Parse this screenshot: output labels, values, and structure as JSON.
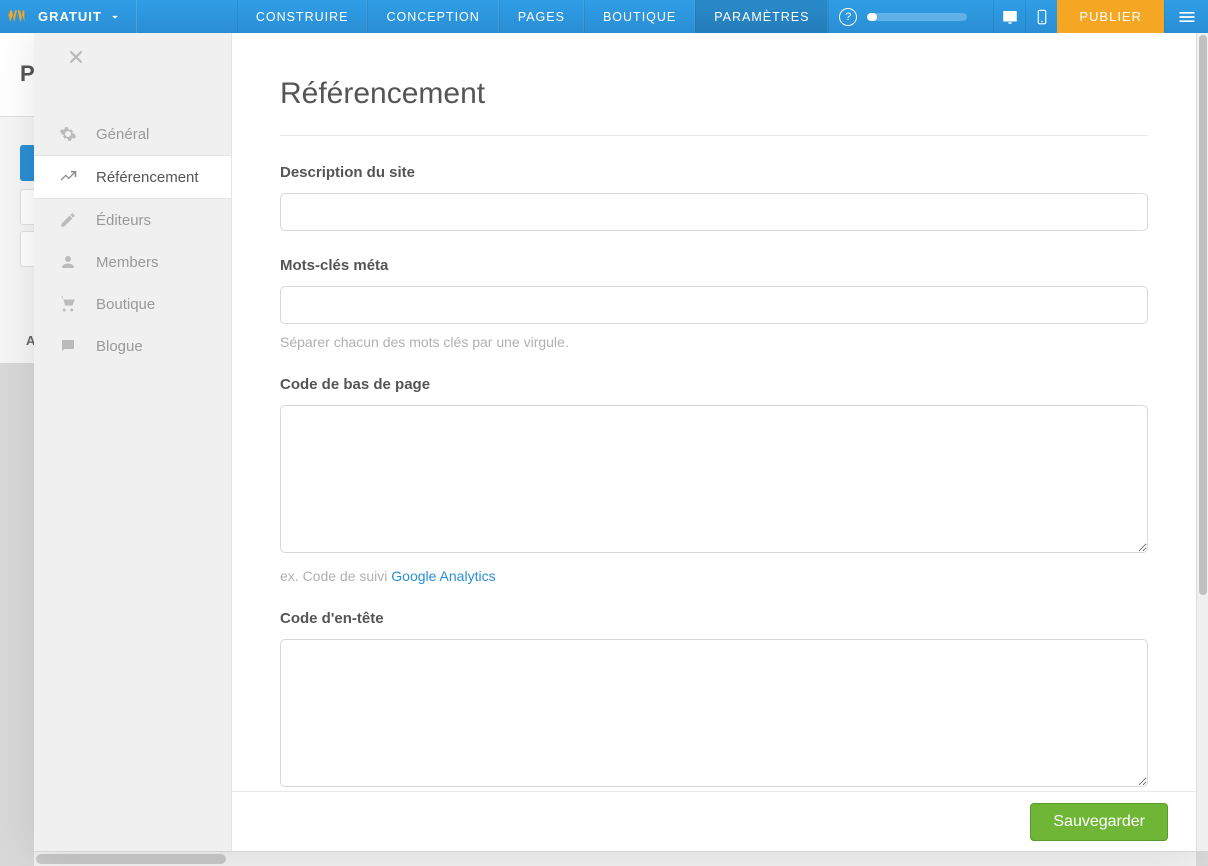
{
  "topbar": {
    "plan_label": "GRATUIT",
    "nav": [
      {
        "label": "CONSTRUIRE"
      },
      {
        "label": "CONCEPTION"
      },
      {
        "label": "PAGES"
      },
      {
        "label": "BOUTIQUE"
      },
      {
        "label": "PARAMÈTRES"
      }
    ],
    "publish_label": "PUBLIER"
  },
  "bg": {
    "page_title_initial": "P",
    "letter": "A"
  },
  "sidebar": {
    "items": [
      {
        "label": "Général"
      },
      {
        "label": "Référencement"
      },
      {
        "label": "Éditeurs"
      },
      {
        "label": "Members"
      },
      {
        "label": "Boutique"
      },
      {
        "label": "Blogue"
      }
    ]
  },
  "main": {
    "title": "Référencement",
    "fields": {
      "site_description": {
        "label": "Description du site",
        "value": ""
      },
      "meta_keywords": {
        "label": "Mots-clés méta",
        "value": "",
        "hint": "Séparer chacun des mots clés par une virgule."
      },
      "footer_code": {
        "label": "Code de bas de page",
        "value": "",
        "hint_prefix": "ex. Code de suivi ",
        "hint_link": "Google Analytics"
      },
      "header_code": {
        "label": "Code d'en-tête",
        "value": ""
      }
    },
    "save_label": "Sauvegarder"
  }
}
